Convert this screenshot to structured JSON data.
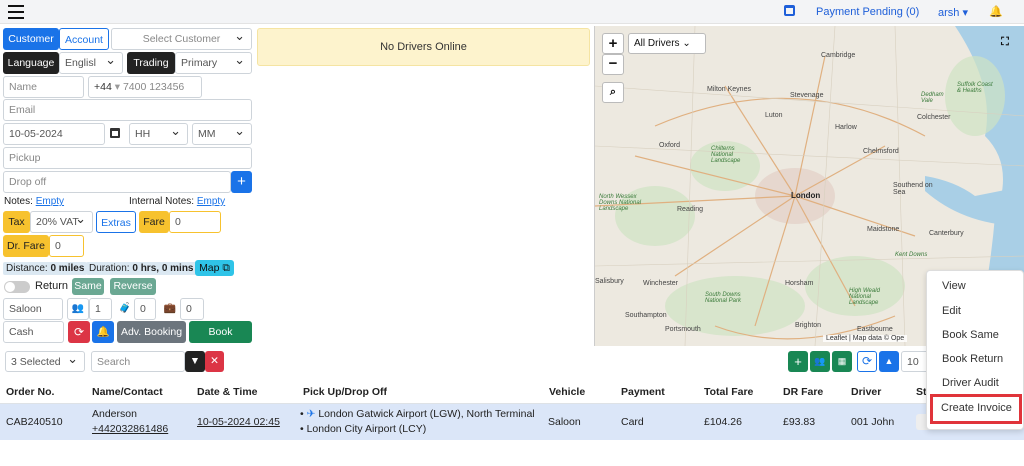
{
  "topbar": {
    "payment_pending": "Payment Pending (0)",
    "user": "arsh"
  },
  "form": {
    "customer_tab": "Customer",
    "account_tab": "Account",
    "select_customer": "Select Customer",
    "language_label": "Language",
    "language_value": "Englisl",
    "trading_label": "Trading",
    "trading_value": "Primary",
    "name_ph": "Name",
    "phone_code": "+44",
    "phone_ph": "7400 123456",
    "email_ph": "Email",
    "date": "10-05-2024",
    "hh": "HH",
    "mm": "MM",
    "pickup_ph": "Pickup",
    "dropoff_ph": "Drop off",
    "add_btn": "+",
    "notes_label": "Notes:",
    "notes_value": "Empty",
    "internal_label": "Internal Notes:",
    "internal_value": "Empty",
    "tax_label": "Tax",
    "tax_value": "20% VAT",
    "extras": "Extras",
    "fare_label": "Fare",
    "fare_value": "0",
    "drfare_label": "Dr. Fare",
    "drfare_value": "0",
    "distance_label": "Distance:",
    "distance_value": "0 miles",
    "duration_label": "Duration:",
    "duration_value": "0 hrs, 0 mins",
    "map_btn": "Map",
    "return_label": "Return",
    "same_btn": "Same",
    "reverse_btn": "Reverse",
    "vehicle": "Saloon",
    "passengers": "1",
    "bags": "0",
    "luggage": "0",
    "payment": "Cash",
    "adv_booking": "Adv. Booking",
    "book": "Book"
  },
  "drivers_banner": "No Drivers Online",
  "map": {
    "filter": "All Drivers",
    "attribution": "Leaflet | Map data © Ope",
    "places": [
      "Cambridge",
      "Milton Keynes",
      "Colchester",
      "Stevenage",
      "Harlow",
      "Chelmsford",
      "Oxford",
      "Luton",
      "Southend on Sea",
      "London",
      "Reading",
      "Maidstone",
      "Winchester",
      "Southampton",
      "Horsham",
      "Brighton",
      "North Wessex Downs National Landscape",
      "Chilterns National Landscape",
      "South Downs National Park",
      "Kent Downs",
      "High Weald National Landscape",
      "Suffolk Coast & Heaths",
      "Dedham Vale",
      "Portsmouth",
      "Salisbury",
      "Canterbury",
      "Eastbourne"
    ]
  },
  "toolbar": {
    "selected": "3 Selected",
    "search_ph": "Search",
    "per_page": "10"
  },
  "table": {
    "headers": [
      "Order No.",
      "Name/Contact",
      "Date & Time",
      "Pick Up/Drop Off",
      "Vehicle",
      "Payment",
      "Total Fare",
      "DR Fare",
      "Driver",
      "St"
    ],
    "row": {
      "order": "CAB240510",
      "name": "Anderson",
      "contact": "+442032861486",
      "datetime": "10-05-2024 02:45",
      "pickup": "London Gatwick Airport (LGW), North Terminal",
      "dropoff": "London City Airport (LCY)",
      "vehicle": "Saloon",
      "payment": "Card",
      "total": "£104.26",
      "dr": "£93.83",
      "driver": "001 John"
    }
  },
  "context_menu": [
    "View",
    "Edit",
    "Book Same",
    "Book Return",
    "Driver Audit",
    "Create Invoice"
  ],
  "colors": {
    "primary": "#1a73e8",
    "success": "#198754",
    "warning": "#f7c22e",
    "danger": "#dc3545",
    "highlight": "#e0343a"
  }
}
